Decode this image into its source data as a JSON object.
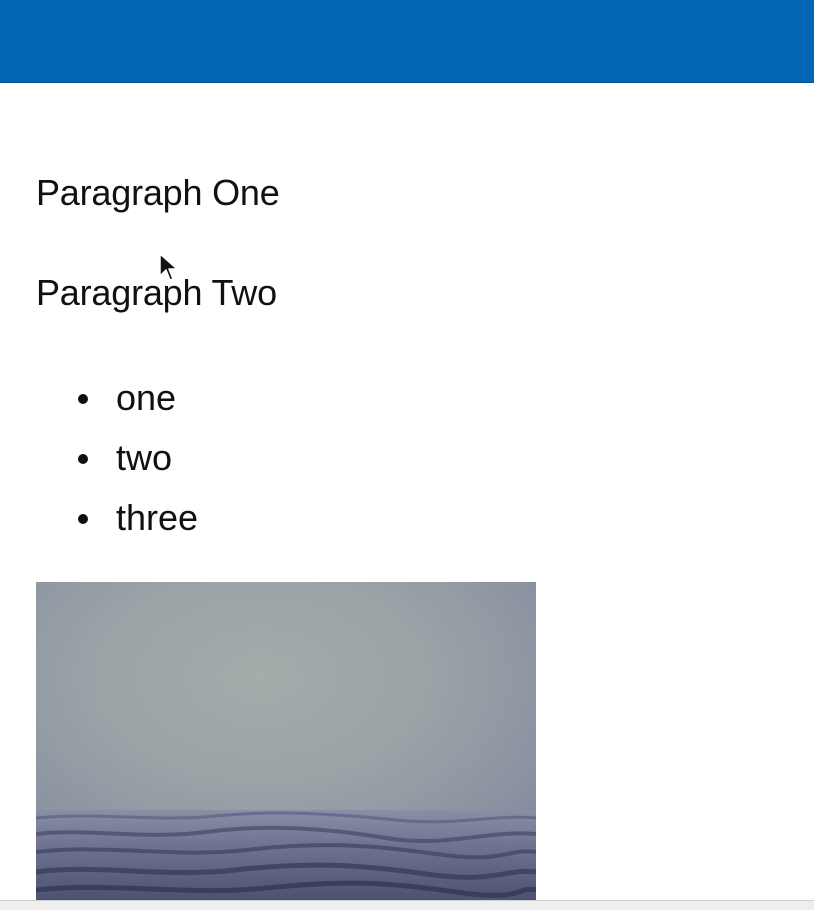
{
  "page": {
    "paragraphs": [
      "Paragraph One",
      "Paragraph Two"
    ],
    "list_items": [
      "one",
      "two",
      "three"
    ],
    "image": {
      "kind": "photo",
      "icon": "foggy-sea-photo"
    }
  },
  "colors": {
    "header_bar": "#0366b4",
    "background": "#ffffff",
    "text": "#111111"
  },
  "cursor": {
    "icon": "arrow-cursor-icon"
  }
}
